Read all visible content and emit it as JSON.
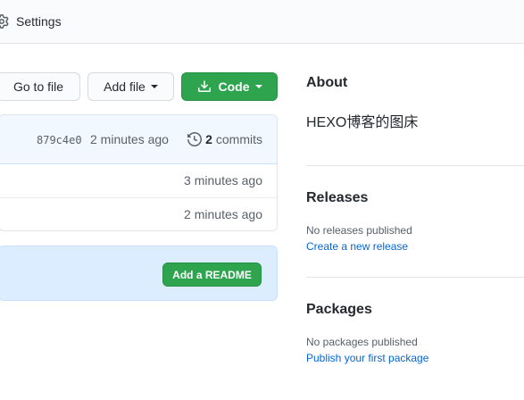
{
  "topbar": {
    "settings_label": "Settings",
    "settings_icon": "gear-icon"
  },
  "toolbar": {
    "go_to_file": "Go to file",
    "add_file": "Add file",
    "code": "Code"
  },
  "commit": {
    "sha": "879c4e0",
    "time": "2 minutes ago",
    "count": "2",
    "count_label": "commits"
  },
  "files": [
    {
      "time": "3 minutes ago"
    },
    {
      "time": "2 minutes ago"
    }
  ],
  "readme": {
    "button_label": "Add a README"
  },
  "about": {
    "heading": "About",
    "description": "HEXO博客的图床"
  },
  "releases": {
    "heading": "Releases",
    "empty_text": "No releases published",
    "link": "Create a new release"
  },
  "packages": {
    "heading": "Packages",
    "empty_text": "No packages published",
    "link": "Publish your first package"
  },
  "colors": {
    "green": "#2ea44f",
    "link": "#0366d6",
    "commit_bg": "#f1f8ff",
    "readme_bg": "#dbedff"
  }
}
